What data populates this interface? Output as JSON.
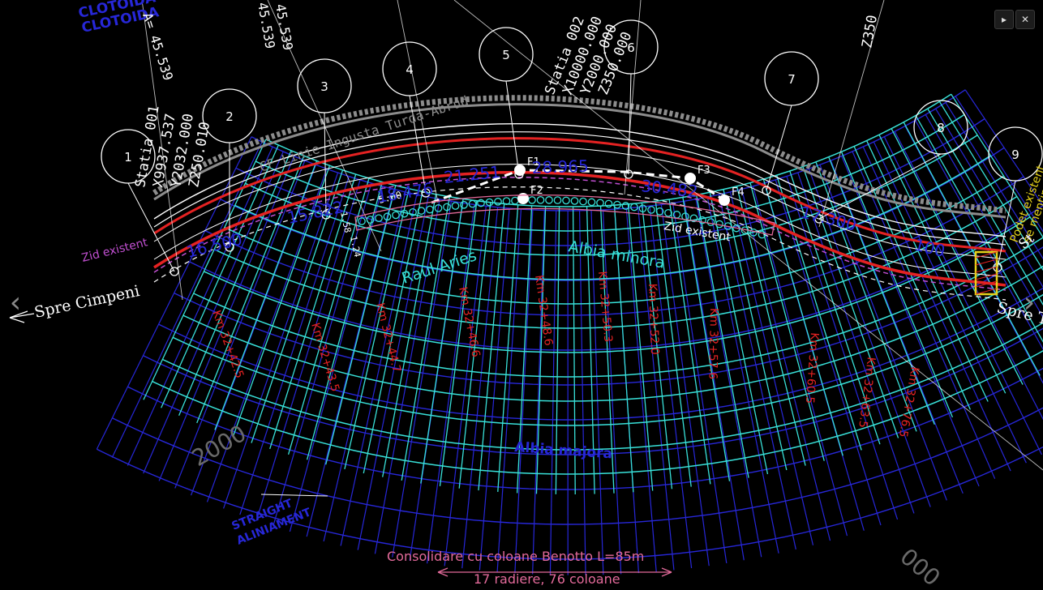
{
  "viewer": {
    "play_icon": "▸",
    "close_icon": "✕",
    "prev_icon": "‹",
    "next_icon": "›"
  },
  "drawing": {
    "colors": {
      "background": "#000000",
      "grid_cyan": "#38e0d8",
      "grid_blue": "#2727d8",
      "red": "#e52222",
      "white": "#ffffff",
      "magenta": "#c04fd0",
      "yellow": "#e6d21a",
      "gray": "#8c8c8c",
      "pink": "#e36a9a"
    },
    "labels": {
      "clothoid": "CLOTOIDA",
      "a_param": "A= 45.539",
      "a_param2": "45.539",
      "a_param3": "45.539",
      "station1": [
        "Statia 001",
        "X9937.537",
        "Y2032.000",
        "Z250.010"
      ],
      "station2": [
        "Statia 002",
        "X10000.000",
        "Y2000.000",
        "Z350.000"
      ],
      "z_right": "Z350",
      "railway": "CF Linie Ingusta Turda-Abrud",
      "existing_wall_left": "Zid existent",
      "existing_wall_right": "Zid existent",
      "river": "Raul Aries",
      "minor_bed": "Albia minora",
      "major_bed": "Albia majora",
      "toward_left": "Spre Cimpeni",
      "toward_right": "Spre Tu",
      "culvert": [
        "Podet existent",
        "se mentine"
      ],
      "benotto_title": "Consolidare cu coloane Benotto L=85m",
      "benotto_sub": "17 radiere, 76 coloane",
      "straight": [
        "STRAIGHT",
        "ALINIAMENT"
      ],
      "dim_500": "5.00",
      "dim_158": "1.58",
      "dim_124": "1.24",
      "large_200": "2000",
      "large_000": "000",
      "ssi": "St"
    },
    "circles": [
      "1",
      "2",
      "3",
      "4",
      "5",
      "6",
      "7",
      "8",
      "9"
    ],
    "fix_points": [
      "F1",
      "F2",
      "F3",
      "F4"
    ],
    "red_dimensions": [
      "16.500",
      "15.822",
      "18.476",
      "21.251",
      "28.965",
      "30.482",
      "17.300",
      "100"
    ],
    "km_labels": [
      "Km 32+42.5",
      "Km 32+43.5",
      "Km 32+44.7",
      "Km 32+46.6",
      "Km 32+48.6",
      "Km 32+50.3",
      "Km 32+52.0",
      "Km 32+57.6",
      "Km 32+60.5",
      "Km 32+63.5",
      "Km 32+76.5"
    ]
  }
}
